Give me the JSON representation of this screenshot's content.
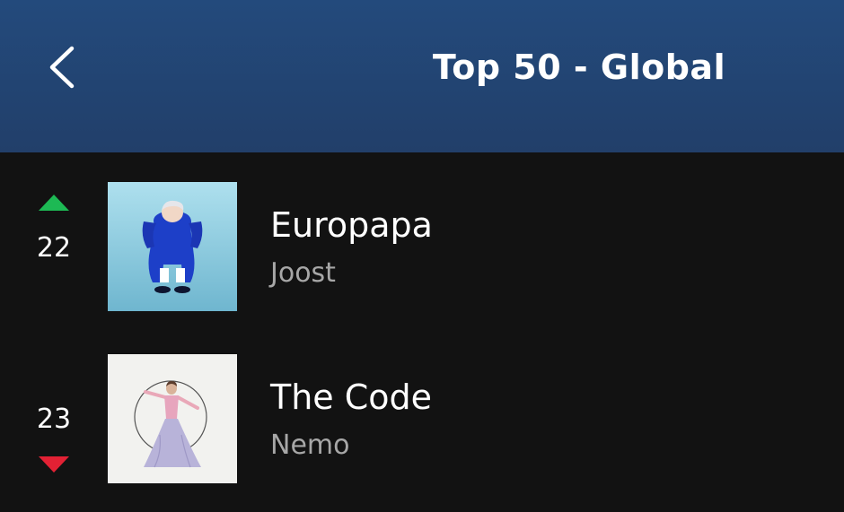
{
  "header": {
    "title": "Top 50 - Global",
    "back_icon": "chevron-left-icon"
  },
  "colors": {
    "header_bg": "#234a7c",
    "background": "#121212",
    "up_arrow": "#1db954",
    "down_arrow": "#e22134",
    "secondary_text": "#a7a7a7"
  },
  "tracks": [
    {
      "rank": "22",
      "trend": "up",
      "title": "Europapa",
      "artist": "Joost"
    },
    {
      "rank": "23",
      "trend": "down",
      "title": "The Code",
      "artist": "Nemo"
    }
  ]
}
